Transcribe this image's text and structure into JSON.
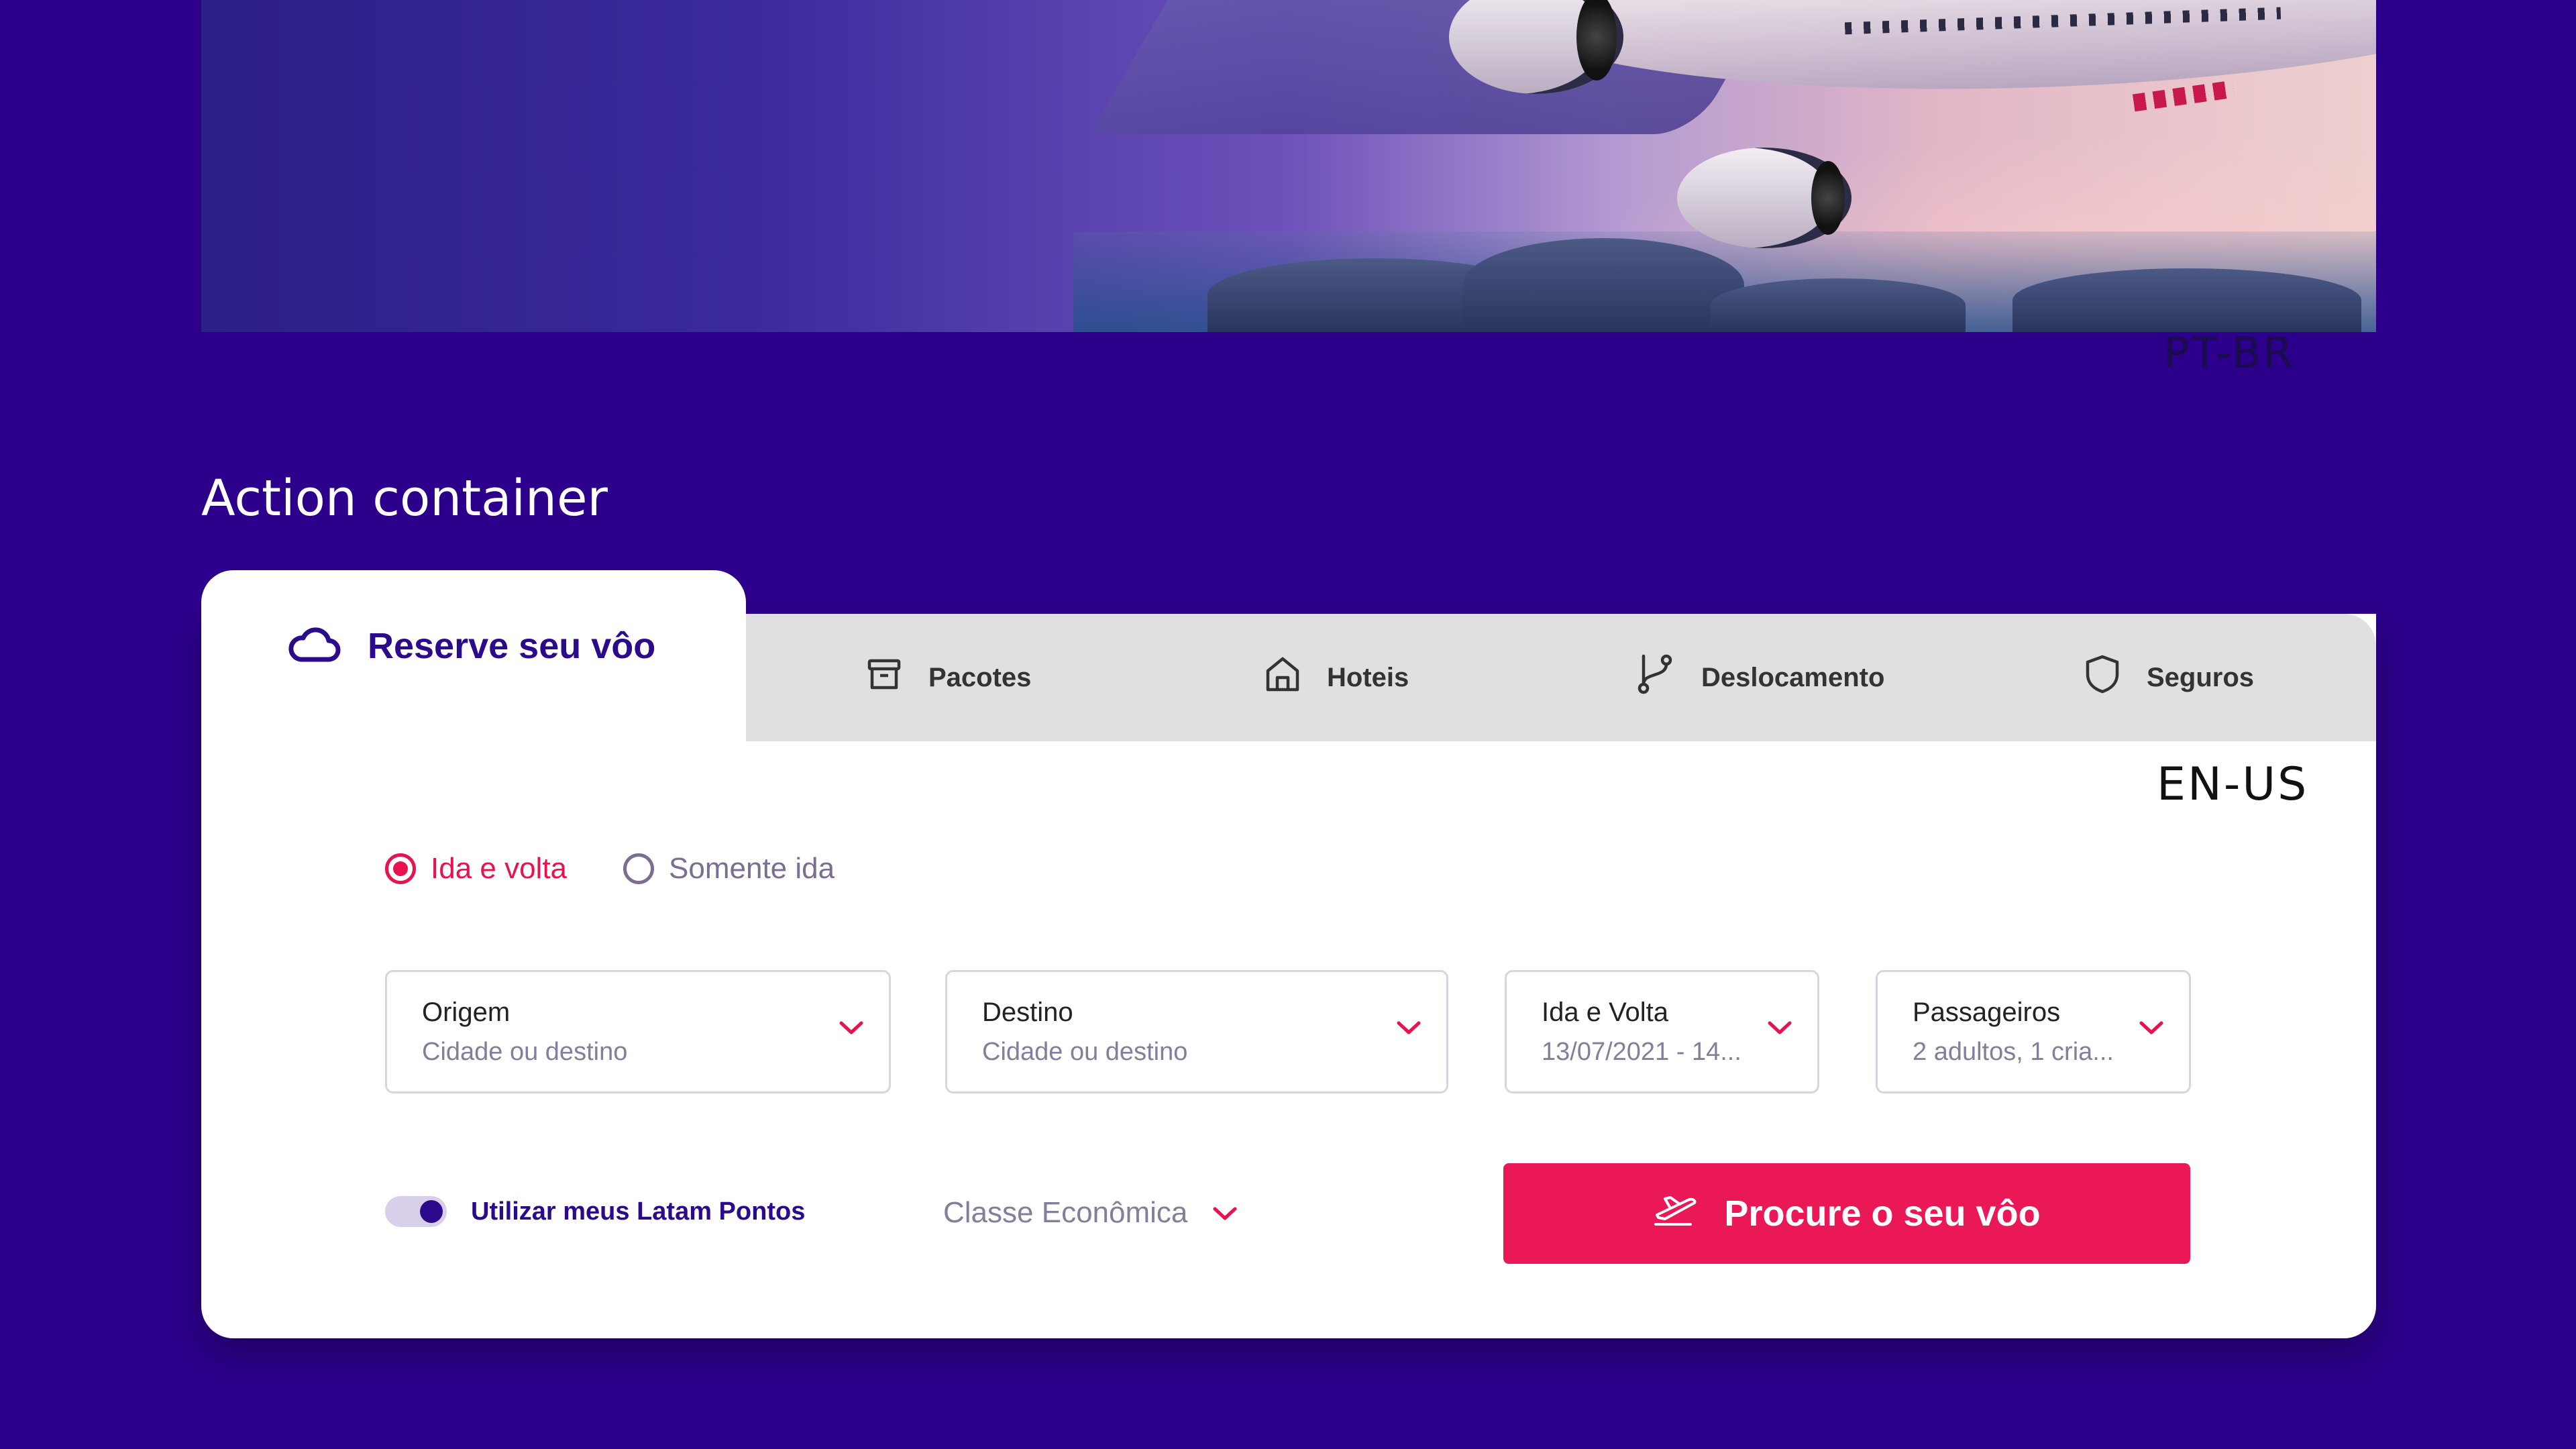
{
  "locales": {
    "top": "PT-BR",
    "card": "EN-US"
  },
  "section_title": "Action container",
  "tabs": {
    "active": {
      "label": "Reserve seu vôo",
      "icon": "cloud-icon"
    },
    "items": [
      {
        "label": "Pacotes",
        "icon": "package-box-icon"
      },
      {
        "label": "Hoteis",
        "icon": "home-icon"
      },
      {
        "label": "Deslocamento",
        "icon": "route-icon"
      },
      {
        "label": "Seguros",
        "icon": "shield-icon"
      }
    ]
  },
  "trip_type": {
    "options": [
      {
        "label": "Ida e volta",
        "selected": true
      },
      {
        "label": "Somente ida",
        "selected": false
      }
    ]
  },
  "fields": {
    "origin": {
      "label": "Origem",
      "value": "Cidade ou destino"
    },
    "destination": {
      "label": "Destino",
      "value": "Cidade ou destino"
    },
    "dates": {
      "label": "Ida e Volta",
      "value": "13/07/2021 - 14..."
    },
    "passengers": {
      "label": "Passageiros",
      "value": "2 adultos, 1 cria..."
    }
  },
  "points_toggle": {
    "label": "Utilizar meus Latam Pontos",
    "on": true
  },
  "cabin_class": {
    "value": "Classe Econômica"
  },
  "search_button": {
    "label": "Procure o seu vôo",
    "icon": "plane-takeoff-icon"
  },
  "colors": {
    "background": "#2d008c",
    "brand_purple": "#2b0a8c",
    "accent_red": "#ea1857",
    "tab_inactive_bg": "#e0e0e0"
  }
}
